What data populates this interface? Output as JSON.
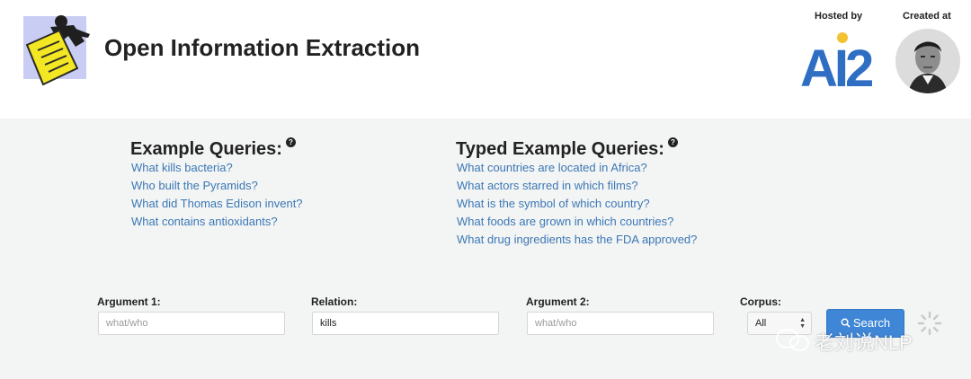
{
  "header": {
    "title": "Open Information Extraction",
    "hosted_label": "Hosted by",
    "created_label": "Created at",
    "ai2_logo_text": "AI2",
    "logo_icon": "robber-with-document-icon"
  },
  "examples": {
    "heading": "Example Queries:",
    "help_icon_glyph": "?",
    "items": [
      "What kills bacteria?",
      "Who built the Pyramids?",
      "What did Thomas Edison invent?",
      "What contains antioxidants?"
    ]
  },
  "typed_examples": {
    "heading": "Typed Example Queries:",
    "help_icon_glyph": "?",
    "items": [
      "What countries are located in Africa?",
      "What actors starred in which films?",
      "What is the symbol of which country?",
      "What foods are grown in which countries?",
      "What drug ingredients has the FDA approved?"
    ]
  },
  "form": {
    "arg1_label": "Argument 1:",
    "arg1_placeholder": "what/who",
    "arg1_value": "",
    "relation_label": "Relation:",
    "relation_value": "kills",
    "relation_placeholder": "",
    "arg2_label": "Argument 2:",
    "arg2_placeholder": "what/who",
    "arg2_value": "",
    "corpus_label": "Corpus:",
    "corpus_selected": "All",
    "search_label": "Search",
    "search_icon": "magnifier-icon"
  },
  "watermark": {
    "text": "老刘说NLP"
  },
  "colors": {
    "link": "#3b78b5",
    "button": "#3f86d6",
    "page_bg": "#f3f4f4",
    "header_bg": "#ffffff",
    "ai2_blue": "#2f6fc3",
    "ai2_yellow": "#f2c230"
  }
}
